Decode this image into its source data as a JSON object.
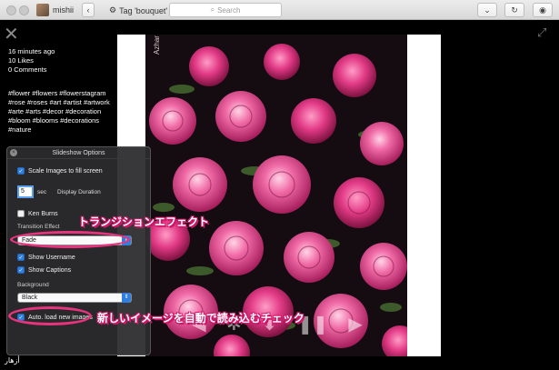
{
  "window": {
    "username": "mishii",
    "title": "Tag 'bouquet'",
    "search_placeholder": "Search"
  },
  "post": {
    "time_ago": "16 minutes ago",
    "likes": "10 Likes",
    "comments": "0 Comments",
    "hashtags": "#flower #flowers #flowerstagram #rose #roses #art #artist #artwork #arte #arts #decor #decoration #bloom #blooms #decorations #nature",
    "author": "أزهار",
    "watermark": "Azhar"
  },
  "slideshow_options": {
    "title": "Slideshow Options",
    "scale_images": {
      "label": "Scale Images to fill screen",
      "checked": true
    },
    "duration_value": "5",
    "duration_unit": "sec",
    "duration_label": "Display Duration",
    "ken_burns": {
      "label": "Ken Burns",
      "checked": false
    },
    "transition_label": "Transition Effect",
    "transition_value": "Fade",
    "show_username": {
      "label": "Show Username",
      "checked": true
    },
    "show_captions": {
      "label": "Show Captions",
      "checked": true
    },
    "background_label": "Background",
    "background_value": "Black",
    "auto_load": {
      "label": "Auto. load new images",
      "checked": true
    }
  },
  "annotations": {
    "transition_note": "トランジションエフェクト",
    "autoload_note": "新しいイメージを自動で読み込むチェック",
    "color": "#e8337e"
  },
  "icons": {
    "close": "close-icon",
    "expand": "expand-icon",
    "back": "chevron-left-icon",
    "tag": "gear-icon",
    "search": "search-icon",
    "download": "double-chevron-down-icon",
    "refresh": "refresh-icon",
    "share": "share-icon",
    "app": "app-icon"
  }
}
